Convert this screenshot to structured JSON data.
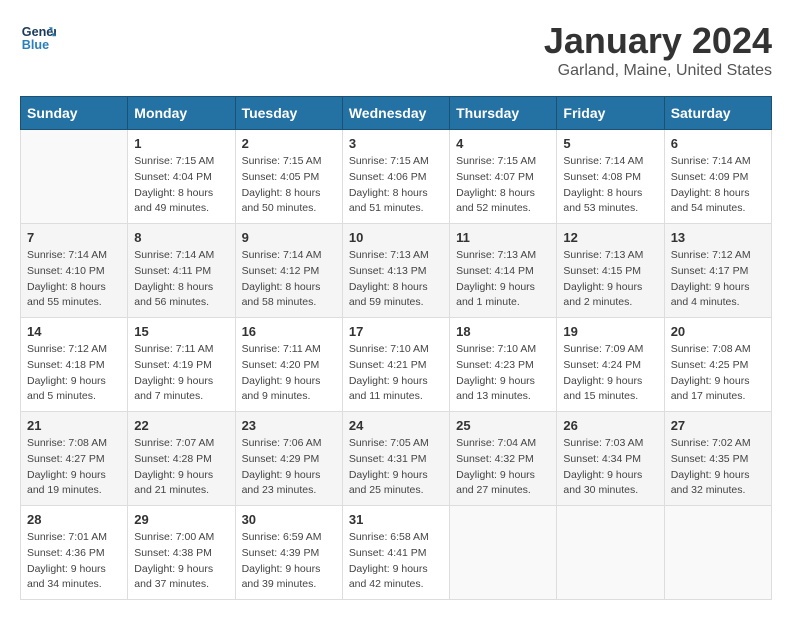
{
  "logo": {
    "line1": "General",
    "line2": "Blue"
  },
  "title": "January 2024",
  "subtitle": "Garland, Maine, United States",
  "days_of_week": [
    "Sunday",
    "Monday",
    "Tuesday",
    "Wednesday",
    "Thursday",
    "Friday",
    "Saturday"
  ],
  "weeks": [
    [
      {
        "day": "",
        "sunrise": "",
        "sunset": "",
        "daylight": ""
      },
      {
        "day": "1",
        "sunrise": "Sunrise: 7:15 AM",
        "sunset": "Sunset: 4:04 PM",
        "daylight": "Daylight: 8 hours and 49 minutes."
      },
      {
        "day": "2",
        "sunrise": "Sunrise: 7:15 AM",
        "sunset": "Sunset: 4:05 PM",
        "daylight": "Daylight: 8 hours and 50 minutes."
      },
      {
        "day": "3",
        "sunrise": "Sunrise: 7:15 AM",
        "sunset": "Sunset: 4:06 PM",
        "daylight": "Daylight: 8 hours and 51 minutes."
      },
      {
        "day": "4",
        "sunrise": "Sunrise: 7:15 AM",
        "sunset": "Sunset: 4:07 PM",
        "daylight": "Daylight: 8 hours and 52 minutes."
      },
      {
        "day": "5",
        "sunrise": "Sunrise: 7:14 AM",
        "sunset": "Sunset: 4:08 PM",
        "daylight": "Daylight: 8 hours and 53 minutes."
      },
      {
        "day": "6",
        "sunrise": "Sunrise: 7:14 AM",
        "sunset": "Sunset: 4:09 PM",
        "daylight": "Daylight: 8 hours and 54 minutes."
      }
    ],
    [
      {
        "day": "7",
        "sunrise": "Sunrise: 7:14 AM",
        "sunset": "Sunset: 4:10 PM",
        "daylight": "Daylight: 8 hours and 55 minutes."
      },
      {
        "day": "8",
        "sunrise": "Sunrise: 7:14 AM",
        "sunset": "Sunset: 4:11 PM",
        "daylight": "Daylight: 8 hours and 56 minutes."
      },
      {
        "day": "9",
        "sunrise": "Sunrise: 7:14 AM",
        "sunset": "Sunset: 4:12 PM",
        "daylight": "Daylight: 8 hours and 58 minutes."
      },
      {
        "day": "10",
        "sunrise": "Sunrise: 7:13 AM",
        "sunset": "Sunset: 4:13 PM",
        "daylight": "Daylight: 8 hours and 59 minutes."
      },
      {
        "day": "11",
        "sunrise": "Sunrise: 7:13 AM",
        "sunset": "Sunset: 4:14 PM",
        "daylight": "Daylight: 9 hours and 1 minute."
      },
      {
        "day": "12",
        "sunrise": "Sunrise: 7:13 AM",
        "sunset": "Sunset: 4:15 PM",
        "daylight": "Daylight: 9 hours and 2 minutes."
      },
      {
        "day": "13",
        "sunrise": "Sunrise: 7:12 AM",
        "sunset": "Sunset: 4:17 PM",
        "daylight": "Daylight: 9 hours and 4 minutes."
      }
    ],
    [
      {
        "day": "14",
        "sunrise": "Sunrise: 7:12 AM",
        "sunset": "Sunset: 4:18 PM",
        "daylight": "Daylight: 9 hours and 5 minutes."
      },
      {
        "day": "15",
        "sunrise": "Sunrise: 7:11 AM",
        "sunset": "Sunset: 4:19 PM",
        "daylight": "Daylight: 9 hours and 7 minutes."
      },
      {
        "day": "16",
        "sunrise": "Sunrise: 7:11 AM",
        "sunset": "Sunset: 4:20 PM",
        "daylight": "Daylight: 9 hours and 9 minutes."
      },
      {
        "day": "17",
        "sunrise": "Sunrise: 7:10 AM",
        "sunset": "Sunset: 4:21 PM",
        "daylight": "Daylight: 9 hours and 11 minutes."
      },
      {
        "day": "18",
        "sunrise": "Sunrise: 7:10 AM",
        "sunset": "Sunset: 4:23 PM",
        "daylight": "Daylight: 9 hours and 13 minutes."
      },
      {
        "day": "19",
        "sunrise": "Sunrise: 7:09 AM",
        "sunset": "Sunset: 4:24 PM",
        "daylight": "Daylight: 9 hours and 15 minutes."
      },
      {
        "day": "20",
        "sunrise": "Sunrise: 7:08 AM",
        "sunset": "Sunset: 4:25 PM",
        "daylight": "Daylight: 9 hours and 17 minutes."
      }
    ],
    [
      {
        "day": "21",
        "sunrise": "Sunrise: 7:08 AM",
        "sunset": "Sunset: 4:27 PM",
        "daylight": "Daylight: 9 hours and 19 minutes."
      },
      {
        "day": "22",
        "sunrise": "Sunrise: 7:07 AM",
        "sunset": "Sunset: 4:28 PM",
        "daylight": "Daylight: 9 hours and 21 minutes."
      },
      {
        "day": "23",
        "sunrise": "Sunrise: 7:06 AM",
        "sunset": "Sunset: 4:29 PM",
        "daylight": "Daylight: 9 hours and 23 minutes."
      },
      {
        "day": "24",
        "sunrise": "Sunrise: 7:05 AM",
        "sunset": "Sunset: 4:31 PM",
        "daylight": "Daylight: 9 hours and 25 minutes."
      },
      {
        "day": "25",
        "sunrise": "Sunrise: 7:04 AM",
        "sunset": "Sunset: 4:32 PM",
        "daylight": "Daylight: 9 hours and 27 minutes."
      },
      {
        "day": "26",
        "sunrise": "Sunrise: 7:03 AM",
        "sunset": "Sunset: 4:34 PM",
        "daylight": "Daylight: 9 hours and 30 minutes."
      },
      {
        "day": "27",
        "sunrise": "Sunrise: 7:02 AM",
        "sunset": "Sunset: 4:35 PM",
        "daylight": "Daylight: 9 hours and 32 minutes."
      }
    ],
    [
      {
        "day": "28",
        "sunrise": "Sunrise: 7:01 AM",
        "sunset": "Sunset: 4:36 PM",
        "daylight": "Daylight: 9 hours and 34 minutes."
      },
      {
        "day": "29",
        "sunrise": "Sunrise: 7:00 AM",
        "sunset": "Sunset: 4:38 PM",
        "daylight": "Daylight: 9 hours and 37 minutes."
      },
      {
        "day": "30",
        "sunrise": "Sunrise: 6:59 AM",
        "sunset": "Sunset: 4:39 PM",
        "daylight": "Daylight: 9 hours and 39 minutes."
      },
      {
        "day": "31",
        "sunrise": "Sunrise: 6:58 AM",
        "sunset": "Sunset: 4:41 PM",
        "daylight": "Daylight: 9 hours and 42 minutes."
      },
      {
        "day": "",
        "sunrise": "",
        "sunset": "",
        "daylight": ""
      },
      {
        "day": "",
        "sunrise": "",
        "sunset": "",
        "daylight": ""
      },
      {
        "day": "",
        "sunrise": "",
        "sunset": "",
        "daylight": ""
      }
    ]
  ]
}
